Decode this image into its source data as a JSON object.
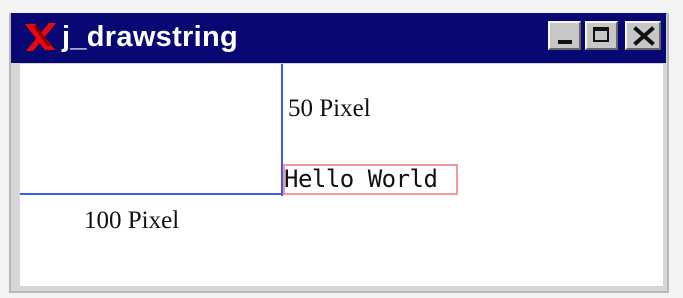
{
  "window": {
    "title": "j_drawstring",
    "icon": "x-logo-icon",
    "controls": {
      "minimize": "minimize-icon",
      "maximize": "maximize-icon",
      "close": "close-icon"
    },
    "colors": {
      "titlebar": "#070874",
      "title_text": "#ffffff",
      "frame": "#d6d6d6",
      "canvas": "#ffffff"
    }
  },
  "canvas": {
    "labels": {
      "vertical_distance": "50 Pixel",
      "horizontal_distance": "100 Pixel",
      "drawn_string": "Hello World"
    },
    "colors": {
      "guide_lines": "#3b5cf4",
      "string_bounds": "#f29a9a"
    }
  }
}
